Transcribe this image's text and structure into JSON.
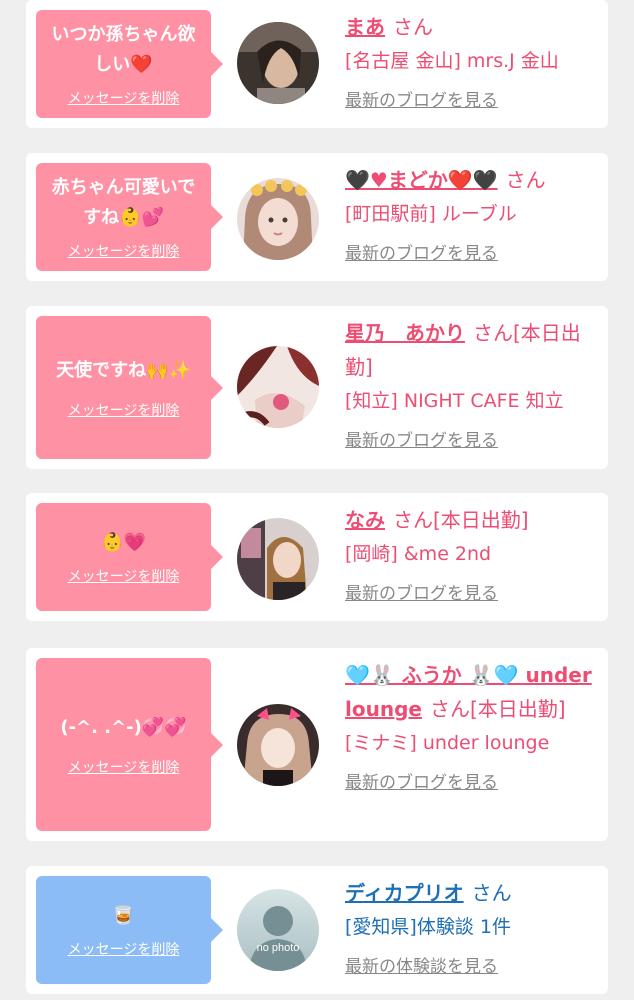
{
  "delete_label": "メッセージを削除",
  "san": "さん",
  "cards": [
    {
      "bubble_text": "いつか孫ちゃん欲しい❤️",
      "name": "まあ",
      "name_suffix": "さん",
      "shop": "[名古屋 金山] mrs.J 金山",
      "link": "最新のブログを見る"
    },
    {
      "bubble_text": "赤ちゃん可愛いですね👶💕",
      "name": "🖤♥まどか❤️🖤",
      "name_suffix": "さん",
      "shop": "[町田駅前] ルーブル",
      "link": "最新のブログを見る"
    },
    {
      "bubble_text": "天使ですね🙌✨",
      "name": "星乃　あかり",
      "name_suffix": "さん[本日出勤]",
      "shop": "[知立] NIGHT CAFE 知立",
      "link": "最新のブログを見る"
    },
    {
      "bubble_text": "👶💗",
      "name": "なみ",
      "name_suffix": "さん[本日出勤]",
      "shop": "[岡崎] &me 2nd",
      "link": "最新のブログを見る"
    },
    {
      "bubble_text": "(-^. .^-)💞💞",
      "name": "🩵🐰 ふうか 🐰🩵 under lounge",
      "name_suffix": "さん[本日出勤]",
      "shop": "[ミナミ] under lounge",
      "link": "最新のブログを見る"
    },
    {
      "bubble_text": "🥃",
      "name": "ディカプリオ",
      "name_suffix": "さん",
      "shop": "[愛知県]体験談 1件",
      "link": "最新の体験談を見る",
      "avatar_label": "no photo"
    }
  ]
}
